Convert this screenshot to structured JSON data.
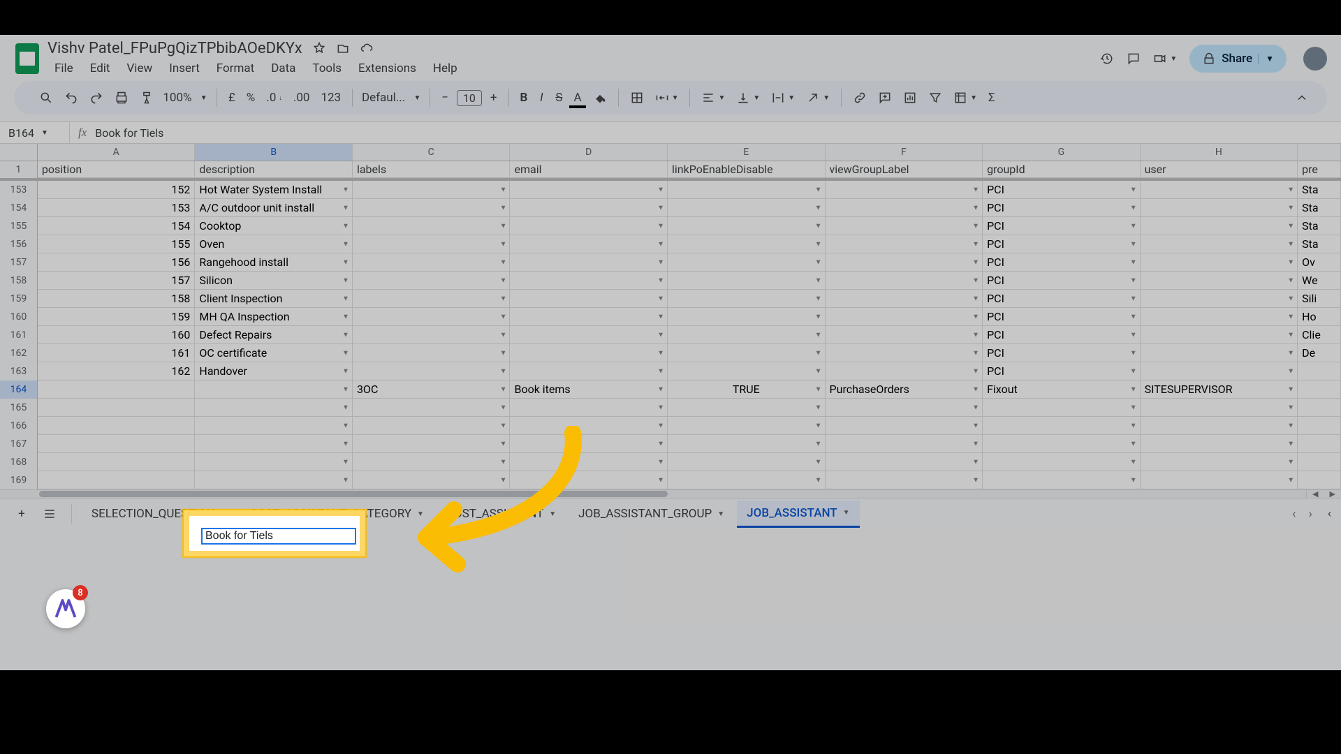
{
  "doc": {
    "title": "Vishv Patel_FPuPgQizTPbibAOeDKYx"
  },
  "menu": [
    "File",
    "Edit",
    "View",
    "Insert",
    "Format",
    "Data",
    "Tools",
    "Extensions",
    "Help"
  ],
  "share": {
    "label": "Share"
  },
  "toolbar": {
    "zoom": "100%",
    "font": "Defaul...",
    "fontsize": "10"
  },
  "namebox": "B164",
  "formula": "Book for Tiels",
  "headers": [
    "A",
    "B",
    "C",
    "D",
    "E",
    "F",
    "G",
    "H"
  ],
  "frozen": {
    "rownum": "1",
    "cells": [
      "position",
      "description",
      "labels",
      "email",
      "linkPoEnableDisable",
      "viewGroupLabel",
      "groupId",
      "user",
      "pre"
    ]
  },
  "rows": [
    {
      "n": "153",
      "a": "152",
      "b": "Hot Water System Install",
      "d": "",
      "e": "",
      "f": "",
      "g": "PCI",
      "h": "",
      "i": "Sta"
    },
    {
      "n": "154",
      "a": "153",
      "b": "A/C outdoor unit install",
      "d": "",
      "e": "",
      "f": "",
      "g": "PCI",
      "h": "",
      "i": "Sta"
    },
    {
      "n": "155",
      "a": "154",
      "b": "Cooktop",
      "d": "",
      "e": "",
      "f": "",
      "g": "PCI",
      "h": "",
      "i": "Sta"
    },
    {
      "n": "156",
      "a": "155",
      "b": "Oven",
      "d": "",
      "e": "",
      "f": "",
      "g": "PCI",
      "h": "",
      "i": "Sta"
    },
    {
      "n": "157",
      "a": "156",
      "b": "Rangehood install",
      "d": "",
      "e": "",
      "f": "",
      "g": "PCI",
      "h": "",
      "i": "Ov"
    },
    {
      "n": "158",
      "a": "157",
      "b": "Silicon",
      "d": "",
      "e": "",
      "f": "",
      "g": "PCI",
      "h": "",
      "i": "We"
    },
    {
      "n": "159",
      "a": "158",
      "b": "Client Inspection",
      "d": "",
      "e": "",
      "f": "",
      "g": "PCI",
      "h": "",
      "i": "Sili"
    },
    {
      "n": "160",
      "a": "159",
      "b": "MH QA Inspection",
      "d": "",
      "e": "",
      "f": "",
      "g": "PCI",
      "h": "",
      "i": "Ho"
    },
    {
      "n": "161",
      "a": "160",
      "b": "Defect Repairs",
      "d": "",
      "e": "",
      "f": "",
      "g": "PCI",
      "h": "",
      "i": "Clie"
    },
    {
      "n": "162",
      "a": "161",
      "b": "OC certificate",
      "d": "",
      "e": "",
      "f": "",
      "g": "PCI",
      "h": "",
      "i": "De"
    },
    {
      "n": "163",
      "a": "162",
      "b": "Handover",
      "d": "",
      "e": "",
      "f": "",
      "g": "PCI",
      "h": "",
      "i": ""
    },
    {
      "n": "164",
      "a": "",
      "b": "",
      "bHidden": "3OC",
      "d": "Book items",
      "e": "TRUE",
      "f": "PurchaseOrders",
      "g": "Fixout",
      "h": "SITESUPERVISOR",
      "i": ""
    },
    {
      "n": "165"
    },
    {
      "n": "166"
    },
    {
      "n": "167"
    },
    {
      "n": "168"
    },
    {
      "n": "169"
    }
  ],
  "editor": {
    "value": "Book for Tiels"
  },
  "ext_badge": {
    "count": "8"
  },
  "sheets": [
    {
      "label": "SELECTION_QUESTION",
      "active": false
    },
    {
      "label": "COST_ASSISTANT_CATEGORY",
      "active": false
    },
    {
      "label": "COST_ASSISTANT",
      "active": false
    },
    {
      "label": "JOB_ASSISTANT_GROUP",
      "active": false
    },
    {
      "label": "JOB_ASSISTANT",
      "active": true
    }
  ]
}
